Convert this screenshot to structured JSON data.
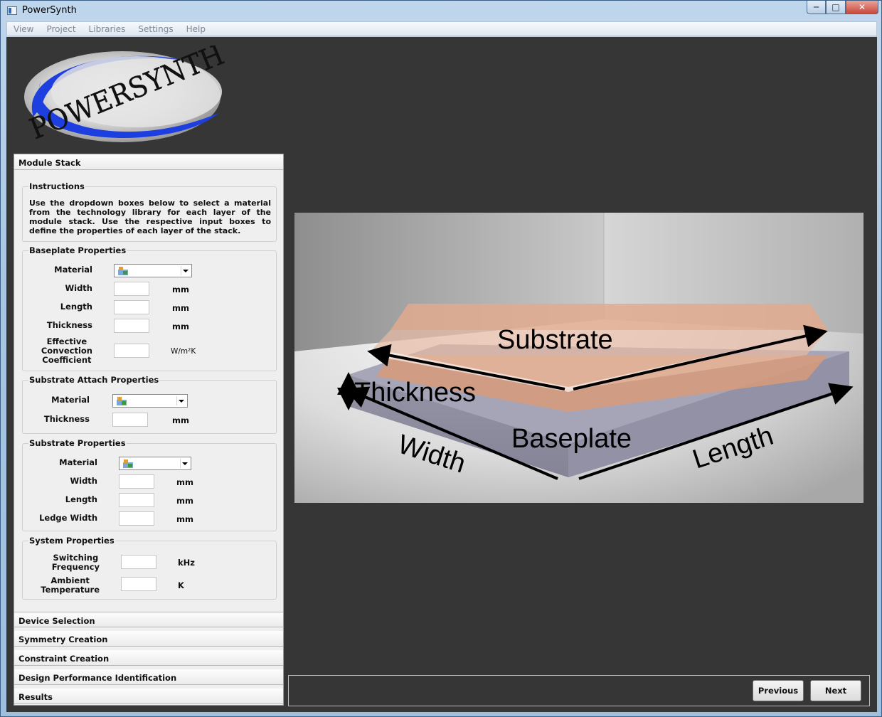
{
  "window": {
    "title": "PowerSynth",
    "controls": [
      "minimize",
      "maximize",
      "close"
    ]
  },
  "menu": [
    "View",
    "Project",
    "Libraries",
    "Settings",
    "Help"
  ],
  "logo": {
    "text": "POWERSYNTH"
  },
  "panel": {
    "module_stack": {
      "header": "Module Stack",
      "instructions": {
        "title": "Instructions",
        "text": "Use the dropdown boxes below to select a material from the technology library for each layer of the module stack. Use the respective input boxes to define the properties of each layer of the stack."
      },
      "baseplate": {
        "title": "Baseplate Properties",
        "material_label": "Material",
        "width_label": "Width",
        "width_value": "",
        "width_unit": "mm",
        "length_label": "Length",
        "length_value": "",
        "length_unit": "mm",
        "thickness_label": "Thickness",
        "thickness_value": "",
        "thickness_unit": "mm",
        "conv_label_1": "Effective",
        "conv_label_2": "Convection",
        "conv_label_3": "Coefficient",
        "conv_value": "",
        "conv_unit": "W/m²K"
      },
      "substrate_attach": {
        "title": "Substrate Attach Properties",
        "material_label": "Material",
        "thickness_label": "Thickness",
        "thickness_value": "",
        "thickness_unit": "mm"
      },
      "substrate": {
        "title": "Substrate Properties",
        "material_label": "Material",
        "width_label": "Width",
        "width_value": "",
        "width_unit": "mm",
        "length_label": "Length",
        "length_value": "",
        "length_unit": "mm",
        "ledge_label": "Ledge Width",
        "ledge_value": "",
        "ledge_unit": "mm"
      },
      "system": {
        "title": "System Properties",
        "freq_label_1": "Switching",
        "freq_label_2": "Frequency",
        "freq_value": "",
        "freq_unit": "kHz",
        "temp_label_1": "Ambient",
        "temp_label_2": "Temperature",
        "temp_value": "",
        "temp_unit": "K"
      }
    },
    "sections": [
      "Device Selection",
      "Symmetry Creation",
      "Constraint Creation",
      "Design Performance Identification",
      "Results"
    ]
  },
  "scene": {
    "labels": {
      "substrate": "Substrate",
      "thickness": "Thickness",
      "baseplate": "Baseplate",
      "width": "Width",
      "length": "Length"
    }
  },
  "nav": {
    "previous": "Previous",
    "next": "Next"
  }
}
